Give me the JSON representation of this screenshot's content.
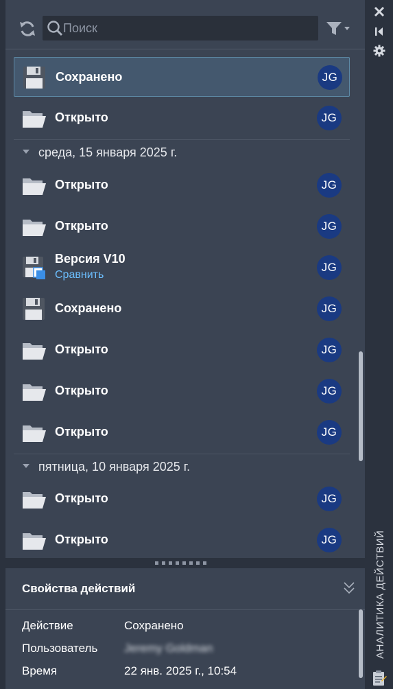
{
  "toolbar": {
    "search_placeholder": "Поиск"
  },
  "entries": [
    {
      "label": "Сохранено",
      "icon": "floppy-disk-icon",
      "user": "JG",
      "selected": true
    },
    {
      "label": "Открыто",
      "icon": "folder-icon",
      "user": "JG"
    }
  ],
  "groups": [
    {
      "label": "среда, 15 января 2025 г.",
      "entries": [
        {
          "label": "Открыто",
          "icon": "folder-icon",
          "user": "JG"
        },
        {
          "label": "Открыто",
          "icon": "folder-icon",
          "user": "JG"
        },
        {
          "label": "Версия V10",
          "link": "Сравнить",
          "icon": "version-disk-icon",
          "user": "JG"
        },
        {
          "label": "Сохранено",
          "icon": "floppy-disk-icon",
          "user": "JG"
        },
        {
          "label": "Открыто",
          "icon": "folder-icon",
          "user": "JG"
        },
        {
          "label": "Открыто",
          "icon": "folder-icon",
          "user": "JG"
        },
        {
          "label": "Открыто",
          "icon": "folder-icon",
          "user": "JG"
        }
      ]
    },
    {
      "label": "пятница, 10 января 2025 г.",
      "entries": [
        {
          "label": "Открыто",
          "icon": "folder-icon",
          "user": "JG"
        },
        {
          "label": "Открыто",
          "icon": "folder-icon",
          "user": "JG"
        }
      ]
    }
  ],
  "properties": {
    "title": "Свойства действий",
    "rows": [
      {
        "key": "Действие",
        "value": "Сохранено"
      },
      {
        "key": "Пользователь",
        "value": "Jeremy Goldman"
      },
      {
        "key": "Время",
        "value": "22 янв. 2025 г., 10:54"
      }
    ]
  },
  "side_strip": {
    "title": "АНАЛИТИКА ДЕЙСТВИЙ"
  },
  "colors": {
    "panel_bg": "#3b4453",
    "dark_bg": "#2b323e",
    "selected_bg": "#44586e",
    "selected_border": "#5e8aa6",
    "avatar_bg": "#1a3a82",
    "link": "#6cbfff"
  }
}
